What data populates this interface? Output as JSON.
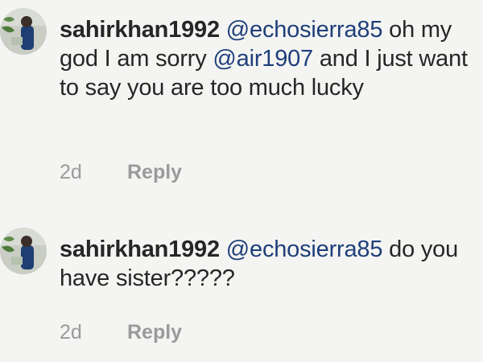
{
  "comments": [
    {
      "username": "sahirkhan1992",
      "mention_1": "@echosierra85",
      "text_1": "oh my god I am sorry",
      "mention_2": "@air1907",
      "text_2": "and I just want to say you are too much lucky",
      "time": "2d",
      "reply_label": "Reply"
    },
    {
      "username": "sahirkhan1992",
      "mention_1": "@echosierra85",
      "text_1": "do you have sister?????",
      "time": "2d",
      "reply_label": "Reply"
    }
  ],
  "colors": {
    "text": "#262626",
    "mention": "#1e3f7a",
    "meta": "#9a9a9a",
    "background": "#f4f4f2"
  }
}
